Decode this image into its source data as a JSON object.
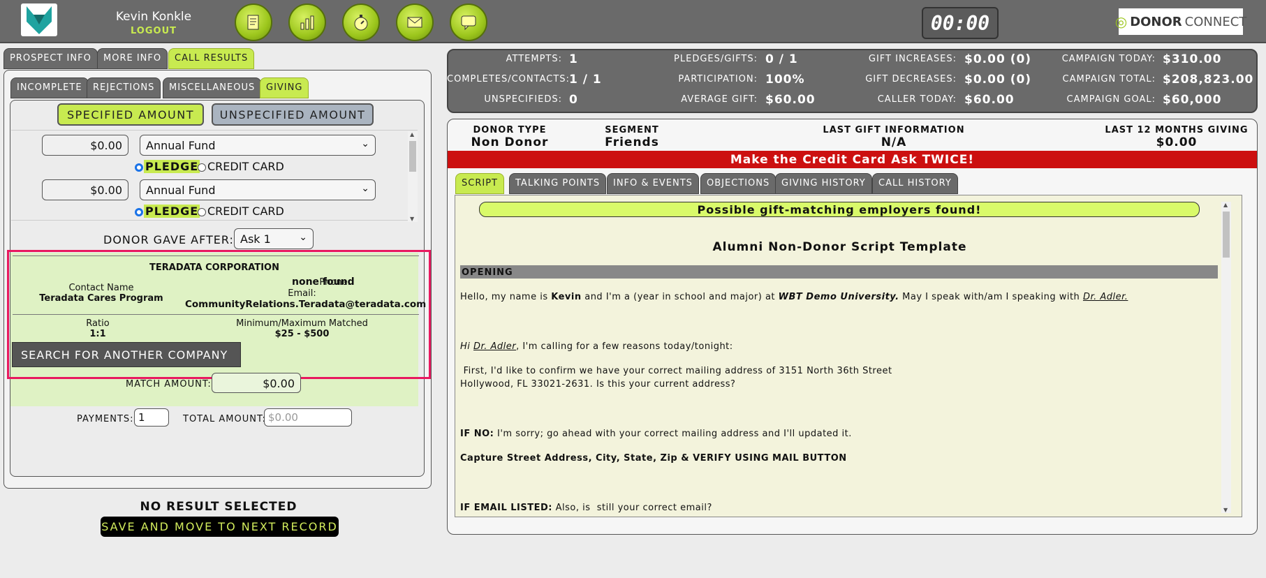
{
  "header": {
    "user_name": "Kevin Konkle",
    "logout_label": "LOGOUT",
    "timer": "00:00",
    "logo_text_bold": "DONOR",
    "logo_text": "CONNECT",
    "toolbar_icons": [
      "notes-icon",
      "chart-icon",
      "stopwatch-icon",
      "mail-icon",
      "chat-icon"
    ]
  },
  "left_tabs": [
    "PROSPECT INFO",
    "MORE INFO",
    "CALL RESULTS"
  ],
  "result_tabs": [
    "INCOMPLETE",
    "REJECTIONS",
    "MISCELLANEOUS",
    "GIVING"
  ],
  "giving": {
    "specified_label": "SPECIFIED AMOUNT",
    "unspecified_label": "UNSPECIFIED AMOUNT",
    "gifts": [
      {
        "amount": "$0.00",
        "fund": "Annual Fund",
        "pledge_label": "PLEDGE",
        "cc_label": "CREDIT CARD"
      },
      {
        "amount": "$0.00",
        "fund": "Annual Fund",
        "pledge_label": "PLEDGE",
        "cc_label": "CREDIT CARD"
      }
    ],
    "donor_gave_after_label": "DONOR GAVE AFTER:",
    "ask_value": "Ask 1"
  },
  "matching": {
    "company": "TERADATA CORPORATION",
    "contact_name_label": "Contact Name",
    "contact_name": "Teradata Cares Program",
    "phone_label": "Phone:",
    "phone_value": "none found",
    "email_label": "Email:",
    "email": "CommunityRelations.Teradata@teradata.com",
    "ratio_label": "Ratio",
    "ratio": "1:1",
    "minmax_label": "Minimum/Maximum Matched",
    "minmax": "$25 - $500",
    "search_button": "SEARCH FOR ANOTHER COMPANY",
    "match_amount_label": "MATCH AMOUNT:",
    "match_amount": "$0.00"
  },
  "payments": {
    "payments_label": "PAYMENTS:",
    "payments_value": "1",
    "total_label": "TOTAL AMOUNT:",
    "total_placeholder": "$0.00"
  },
  "footer": {
    "no_result": "NO RESULT SELECTED",
    "save_next": "SAVE AND MOVE TO NEXT RECORD"
  },
  "stats": {
    "attempts_label": "ATTEMPTS:",
    "attempts": "1",
    "completes_label": "COMPLETES/CONTACTS:",
    "completes": "1 / 1",
    "unspecifieds_label": "UNSPECIFIEDS:",
    "unspecifieds": "0",
    "pledges_label": "PLEDGES/GIFTS:",
    "pledges": "0 / 1",
    "participation_label": "PARTICIPATION:",
    "participation": "100%",
    "average_label": "AVERAGE GIFT:",
    "average": "$60.00",
    "increases_label": "GIFT INCREASES:",
    "increases": "$0.00 (0)",
    "decreases_label": "GIFT DECREASES:",
    "decreases": "$0.00 (0)",
    "caller_today_label": "CALLER TODAY:",
    "caller_today": "$60.00",
    "campaign_today_label": "CAMPAIGN TODAY:",
    "campaign_today": "$310.00",
    "campaign_total_label": "CAMPAIGN TOTAL:",
    "campaign_total": "$208,823.00",
    "campaign_goal_label": "CAMPAIGN GOAL:",
    "campaign_goal": "$60,000"
  },
  "donor": {
    "type_label": "DONOR TYPE",
    "type": "Non Donor",
    "segment_label": "SEGMENT",
    "segment": "Friends",
    "last_gift_label": "LAST GIFT INFORMATION",
    "last_gift": "N/A",
    "last12_label": "LAST 12 MONTHS GIVING",
    "last12": "$0.00"
  },
  "cc_banner": "Make the Credit Card Ask TWICE!",
  "script_tabs": [
    "SCRIPT",
    "TALKING POINTS",
    "INFO & EVENTS",
    "OBJECTIONS",
    "GIVING HISTORY",
    "CALL HISTORY"
  ],
  "script": {
    "matching_banner": "Possible gift-matching employers found!",
    "title": "Alumni Non-Donor Script Template",
    "opening": "OPENING",
    "p1_a": "Hello, my name is ",
    "p1_name": "Kevin",
    "p1_b": " and I'm a (year in school and major) at ",
    "p1_school": "WBT Demo University.",
    "p1_c": " May I speak with/am I speaking with ",
    "p1_prospect": "Dr. Adler.",
    "p2_hi": "Hi ",
    "p2_prospect": "Dr. Adler",
    "p2_rest": ", I'm calling for a few reasons today/tonight:",
    "p3_line1": " First, I'd like to confirm we have your correct mailing address of 3151 North 36th Street",
    "p3_line2": "Hollywood, FL 33021-2631. Is this your current address?",
    "p4_bold": "IF NO:",
    "p4_rest": " I'm sorry; go ahead with your correct mailing address and I'll updated it.",
    "p5": "Capture Street Address, City, State, Zip & VERIFY USING MAIL BUTTON",
    "p6_bold": "IF EMAIL LISTED:",
    "p6_rest": " Also, is  still your correct email?"
  }
}
